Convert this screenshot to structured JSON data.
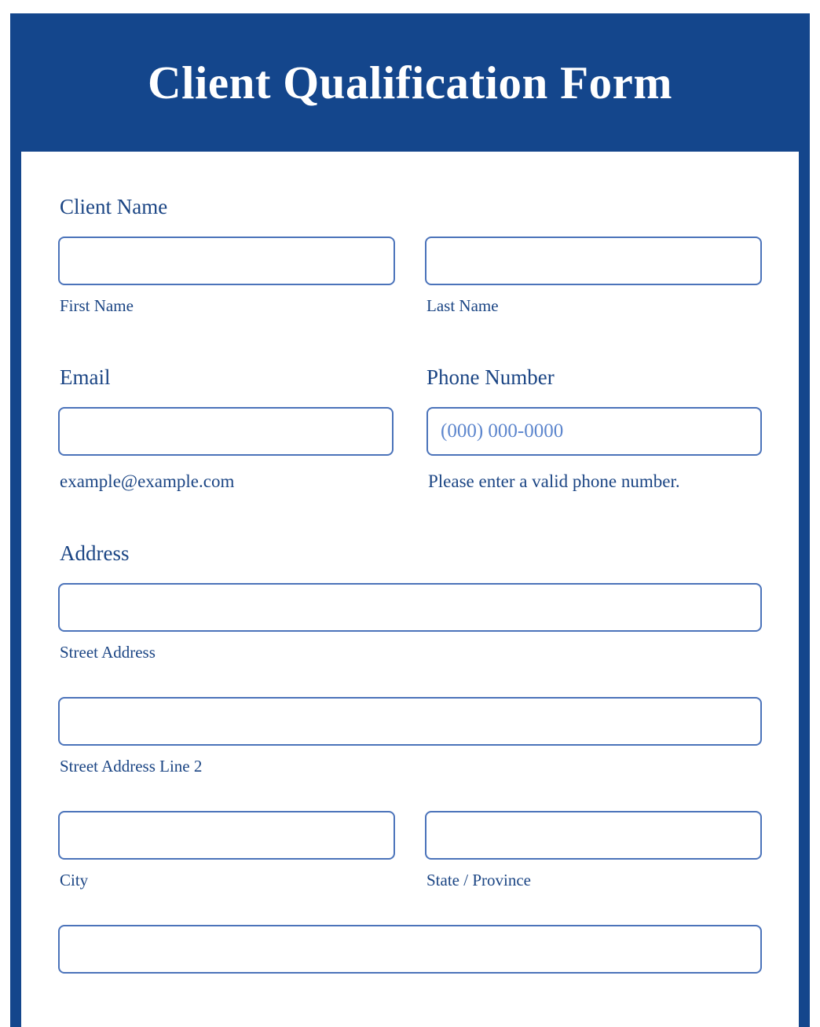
{
  "theme": {
    "frame_color": "#14468c",
    "header_bg": "#14468c",
    "title_color": "#ffffff",
    "label_color": "#1b4584",
    "input_border_color": "#4b73ba",
    "placeholder_color": "#5d86cd",
    "card_bg": "#ffffff"
  },
  "header": {
    "title": "Client Qualification Form"
  },
  "form": {
    "sections": [
      {
        "id": "client-name",
        "label": "Client Name",
        "fields": [
          {
            "id": "first-name",
            "value": "",
            "placeholder": "",
            "sub_label": "First Name"
          },
          {
            "id": "last-name",
            "value": "",
            "placeholder": "",
            "sub_label": "Last Name"
          }
        ]
      },
      {
        "id": "email",
        "label": "Email",
        "fields": [
          {
            "id": "email-input",
            "value": "",
            "placeholder": "",
            "sub_label": "example@example.com"
          }
        ]
      },
      {
        "id": "phone",
        "label": "Phone Number",
        "fields": [
          {
            "id": "phone-input",
            "value": "",
            "placeholder": "(000) 000-0000",
            "sub_label": "Please enter a valid phone number."
          }
        ]
      },
      {
        "id": "address",
        "label": "Address",
        "fields": [
          {
            "id": "street-address",
            "value": "",
            "placeholder": "",
            "sub_label": "Street Address"
          },
          {
            "id": "street-address-line-2",
            "value": "",
            "placeholder": "",
            "sub_label": "Street Address Line 2"
          },
          {
            "id": "city",
            "value": "",
            "placeholder": "",
            "sub_label": "City"
          },
          {
            "id": "state-province",
            "value": "",
            "placeholder": "",
            "sub_label": "State / Province"
          },
          {
            "id": "postal-code",
            "value": "",
            "placeholder": "",
            "sub_label": ""
          }
        ]
      }
    ]
  }
}
